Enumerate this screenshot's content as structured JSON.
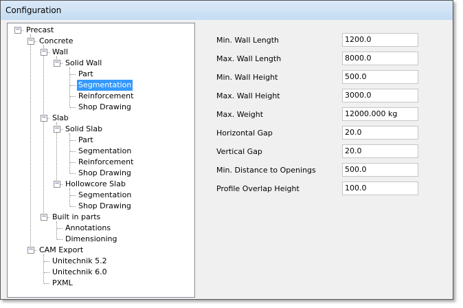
{
  "window": {
    "title": "Configuration"
  },
  "tree": [
    {
      "label": "Precast",
      "level": 0,
      "expanded": true
    },
    {
      "label": "Concrete",
      "level": 1,
      "expanded": true
    },
    {
      "label": "Wall",
      "level": 2,
      "expanded": true
    },
    {
      "label": "Solid Wall",
      "level": 3,
      "expanded": true
    },
    {
      "label": "Part",
      "level": 4
    },
    {
      "label": "Segmentation",
      "level": 4,
      "selected": true
    },
    {
      "label": "Reinforcement",
      "level": 4
    },
    {
      "label": "Shop Drawing",
      "level": 4
    },
    {
      "label": "Slab",
      "level": 2,
      "expanded": true
    },
    {
      "label": "Solid Slab",
      "level": 3,
      "expanded": true
    },
    {
      "label": "Part",
      "level": 4
    },
    {
      "label": "Segmentation",
      "level": 4
    },
    {
      "label": "Reinforcement",
      "level": 4
    },
    {
      "label": "Shop Drawing",
      "level": 4
    },
    {
      "label": "Hollowcore Slab",
      "level": 3,
      "expanded": true
    },
    {
      "label": "Segmentation",
      "level": 4
    },
    {
      "label": "Shop Drawing",
      "level": 4
    },
    {
      "label": "Built in parts",
      "level": 2,
      "expanded": true
    },
    {
      "label": "Annotations",
      "level": 3
    },
    {
      "label": "Dimensioning",
      "level": 3
    },
    {
      "label": "CAM Export",
      "level": 1,
      "expanded": true
    },
    {
      "label": "Unitechnik 5.2",
      "level": 2
    },
    {
      "label": "Unitechnik 6.0",
      "level": 2
    },
    {
      "label": "PXML",
      "level": 2
    }
  ],
  "fields": [
    {
      "label": "Min. Wall Length",
      "value": "1200.0"
    },
    {
      "label": "Max. Wall Length",
      "value": "8000.0"
    },
    {
      "label": "Min. Wall Height",
      "value": "500.0"
    },
    {
      "label": "Max. Wall Height",
      "value": "3000.0"
    },
    {
      "label": "Max. Weight",
      "value": "12000.000 kg"
    },
    {
      "label": "Horizontal Gap",
      "value": "20.0"
    },
    {
      "label": "Vertical Gap",
      "value": "20.0"
    },
    {
      "label": "Min. Distance to Openings",
      "value": "500.0"
    },
    {
      "label": "Profile Overlap Height",
      "value": "100.0"
    }
  ]
}
